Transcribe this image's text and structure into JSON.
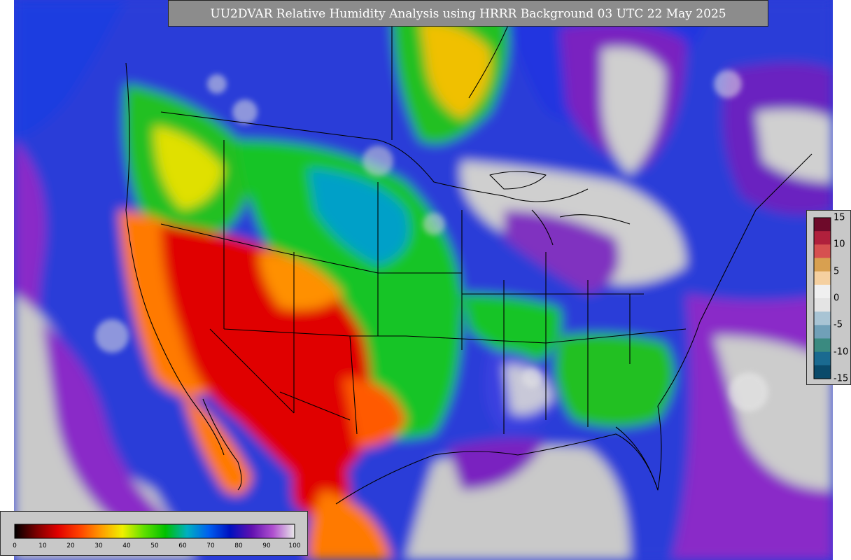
{
  "title": "UU2DVAR Relative Humidity Analysis using HRRR Background 03 UTC 22 May 2025",
  "map": {
    "variable": "Relative Humidity",
    "units": "%",
    "colors": {
      "dry": "#e00000",
      "orange": "#ff7a00",
      "yellow": "#f0f000",
      "green": "#1ec41e",
      "blue": "#1a3ae0",
      "purple": "#7a10c0",
      "saturated": "#cfcfcf",
      "border": "#000000"
    }
  },
  "colorbar": {
    "ticks": [
      "0",
      "10",
      "20",
      "30",
      "40",
      "50",
      "60",
      "70",
      "80",
      "90",
      "100"
    ],
    "colors": [
      "#000000",
      "#7a0000",
      "#e00000",
      "#ff4000",
      "#ff9a00",
      "#f0f000",
      "#60e000",
      "#00c000",
      "#00b0c0",
      "#0060f0",
      "#0010c0",
      "#6010b0",
      "#b050d0",
      "#e8e8e8"
    ]
  },
  "diff_colorbar": {
    "ticks": [
      "15",
      "10",
      "5",
      "0",
      "-5",
      "-10",
      "-15"
    ],
    "colors": [
      "#6e0a2a",
      "#b0203c",
      "#d65050",
      "#d8a050",
      "#f5d0a0",
      "#f0f0f0",
      "#e4e4e4",
      "#a8c4d4",
      "#70a0b8",
      "#3a8a80",
      "#1a6a90",
      "#0a4a6a"
    ]
  }
}
